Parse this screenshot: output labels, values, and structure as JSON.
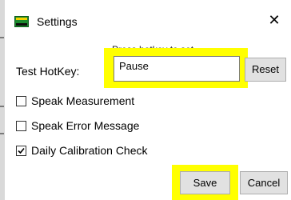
{
  "window": {
    "title": "Settings",
    "close_glyph": "✕",
    "icon": "app-logo-icon"
  },
  "partial_label": "Press hotkey to set",
  "hotkey": {
    "label": "Test HotKey:",
    "value": "Pause",
    "reset_label": "Reset"
  },
  "options": [
    {
      "label": "Speak Measurement",
      "checked": false
    },
    {
      "label": "Speak Error Message",
      "checked": false
    },
    {
      "label": "Daily Calibration Check",
      "checked": true
    }
  ],
  "buttons": {
    "save_label": "Save",
    "cancel_label": "Cancel"
  },
  "colors": {
    "highlight": "#ffff00",
    "button_face": "#e1e1e1",
    "button_border": "#adadad",
    "app_icon_green": "#1b8a2e"
  }
}
